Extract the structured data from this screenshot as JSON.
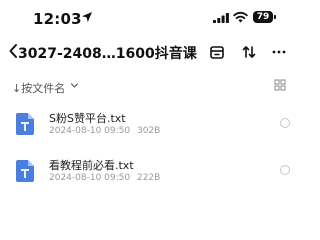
{
  "status_bar": {
    "time": "12:03",
    "battery": "79",
    "icons": [
      "location-arrow-icon",
      "signal-bars-icon",
      "wifi-icon",
      "battery-icon"
    ]
  },
  "nav": {
    "title": "3027-2408…1600抖音课",
    "icons": [
      "back-chevron-icon",
      "archive-icon",
      "sort-arrows-icon",
      "more-icon"
    ]
  },
  "sort": {
    "label": "按文件名",
    "icons": [
      "sort-down-arrow-icon",
      "chevron-down-icon",
      "grid-view-icon"
    ]
  },
  "files": [
    {
      "name": "S粉S赞平台.txt",
      "date": "2024-08-10 09:50",
      "size": "302B",
      "icon": "txt-file-icon"
    },
    {
      "name": "看教程前必看.txt",
      "date": "2024-08-10 09:50",
      "size": "222B",
      "icon": "txt-file-icon"
    }
  ],
  "colors": {
    "file_icon": "#4a7fe0",
    "text": "#111111",
    "meta": "#9a9a9a"
  }
}
